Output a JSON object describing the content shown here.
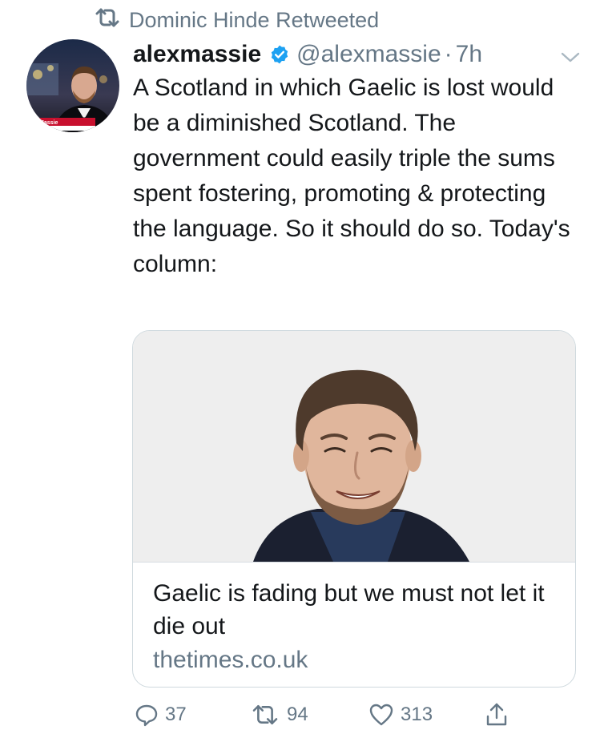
{
  "retweet": {
    "text": "Dominic Hinde Retweeted"
  },
  "tweet": {
    "display_name": "alexmassie",
    "handle": "@alexmassie",
    "separator": "·",
    "time": "7h",
    "text": "A Scotland in which Gaelic is lost would be a diminished Scotland. The government could easily triple the sums spent fostering, promoting & protecting the language. So it should do so. Today's column:",
    "avatar_overlay_label": "Massie"
  },
  "card": {
    "title": "Gaelic is fading but we must not let it die out",
    "domain": "thetimes.co.uk"
  },
  "actions": {
    "replies": "37",
    "retweets": "94",
    "likes": "313"
  },
  "icons": {
    "retweet": "retweet-icon",
    "verified": "verified-badge-icon",
    "more": "chevron-down-icon",
    "reply": "reply-icon",
    "like": "heart-icon",
    "share": "share-icon"
  },
  "colors": {
    "text": "#14171a",
    "secondary": "#657786",
    "verified": "#1da1f2",
    "card_border": "#cfd9de"
  }
}
